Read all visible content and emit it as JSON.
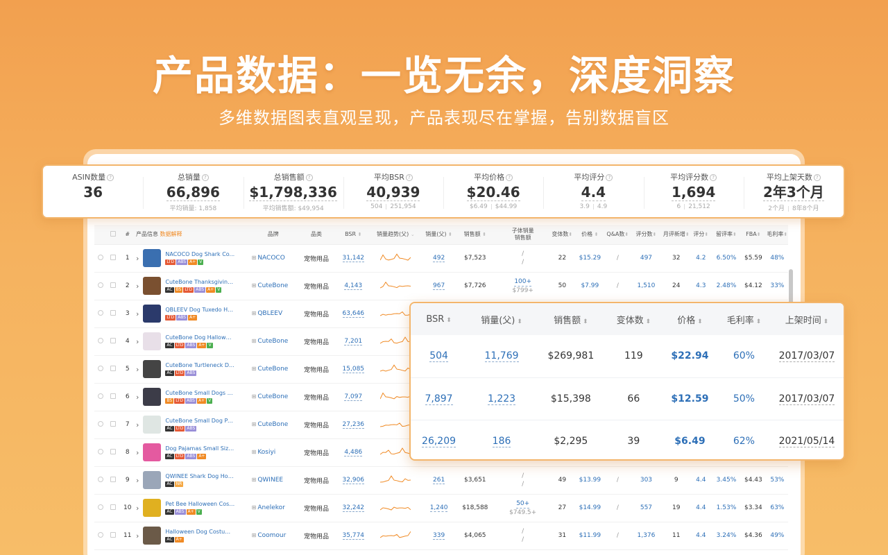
{
  "hero": {
    "title": "产品数据：一览无余，深度洞察",
    "subtitle": "多维数据图表直观呈现，产品表现尽在掌握，告别数据盲区"
  },
  "stats": [
    {
      "label": "ASIN数量",
      "value": "36",
      "sub": ""
    },
    {
      "label": "总销量",
      "value": "66,896",
      "sub": "平均销量: 1,858"
    },
    {
      "label": "总销售额",
      "value": "$1,798,336",
      "sub": "平均销售额: $49,954"
    },
    {
      "label": "平均BSR",
      "value": "40,939",
      "sub_a": "504",
      "sub_b": "251,954"
    },
    {
      "label": "平均价格",
      "value": "$20.46",
      "sub_a": "$6.49",
      "sub_b": "$44.99"
    },
    {
      "label": "平均评分",
      "value": "4.4",
      "sub_a": "3.9",
      "sub_b": "4.9"
    },
    {
      "label": "平均评分数",
      "value": "1,694",
      "sub_a": "6",
      "sub_b": "21,512"
    },
    {
      "label": "平均上架天数",
      "value": "2年3个月",
      "sub_a": "2个月",
      "sub_b": "8年8个月"
    }
  ],
  "table": {
    "headers": {
      "num": "#",
      "product": "产品信息",
      "explain": "数据解释",
      "brand": "品牌",
      "category": "品类",
      "bsr": "BSR",
      "trend": "销量趋势(父)",
      "sales": "销量(父)",
      "revenue": "销售额",
      "child_a": "子体销量",
      "child_b": "销售额",
      "variants": "变体数",
      "price": "价格",
      "qa": "Q&A数",
      "ratings": "评分数",
      "monthly": "月评新增",
      "score": "评分",
      "retention": "留评率",
      "fba": "FBA",
      "margin": "毛利率"
    },
    "rows": [
      {
        "n": "1",
        "name": "NACOCO Dog Shark Co...",
        "tags": [
          "LTD",
          "ABS",
          "A+",
          "V"
        ],
        "brand": "NACOCO",
        "cat": "宠物用品",
        "bsr": "31,142",
        "sales": "492",
        "rev": "$7,523",
        "child": "/",
        "childrev": "/",
        "var": "22",
        "price": "$15.29",
        "qa": "/",
        "ratings": "497",
        "monthly": "32",
        "score": "4.2",
        "ret": "6.50%",
        "fba": "$5.59",
        "margin": "48%",
        "thumb": "#3a6fb0"
      },
      {
        "n": "2",
        "name": "CuteBone Thanksgiving...",
        "tags": [
          "AC",
          "BS",
          "LTD",
          "ABS",
          "A+",
          "V"
        ],
        "brand": "CuteBone",
        "cat": "宠物用品",
        "bsr": "4,143",
        "sales": "967",
        "rev": "$7,726",
        "child": "100+",
        "childrev": "$799+",
        "var": "50",
        "price": "$7.99",
        "qa": "/",
        "ratings": "1,510",
        "monthly": "24",
        "score": "4.3",
        "ret": "2.48%",
        "fba": "$4.12",
        "margin": "33%",
        "thumb": "#7a5030"
      },
      {
        "n": "3",
        "name": "QBLEEV Dog Tuxedo Ha...",
        "tags": [
          "LTD",
          "ABS",
          "A+"
        ],
        "brand": "QBLEEV",
        "cat": "宠物用品",
        "bsr": "63,646",
        "thumb": "#2b3a6b"
      },
      {
        "n": "4",
        "name": "CuteBone Dog Hallowee...",
        "tags": [
          "AC",
          "LTD",
          "ABS",
          "A+",
          "V"
        ],
        "brand": "CuteBone",
        "cat": "宠物用品",
        "bsr": "7,201",
        "thumb": "#e8dfe8"
      },
      {
        "n": "5",
        "name": "CuteBone Turtleneck D...",
        "tags": [
          "AC",
          "LTD",
          "ABS"
        ],
        "brand": "CuteBone",
        "cat": "宠物用品",
        "bsr": "15,085",
        "thumb": "#444"
      },
      {
        "n": "6",
        "name": "CuteBone Small Dogs O...",
        "tags": [
          "BS",
          "LTD",
          "ABS",
          "A+",
          "V"
        ],
        "brand": "CuteBone",
        "cat": "宠物用品",
        "bsr": "7,097",
        "thumb": "#3c3c48"
      },
      {
        "n": "7",
        "name": "CuteBone Small Dog Paj...",
        "tags": [
          "AC",
          "LTD",
          "ABS"
        ],
        "brand": "CuteBone",
        "cat": "宠物用品",
        "bsr": "27,236",
        "thumb": "#dfe6e3"
      },
      {
        "n": "8",
        "name": "Dog Pajamas Small Size...",
        "tags": [
          "AC",
          "LTD",
          "ABS",
          "A+"
        ],
        "brand": "Kosiyi",
        "cat": "宠物用品",
        "bsr": "4,486",
        "thumb": "#e45aa0"
      },
      {
        "n": "9",
        "name": "QWINEE Shark Dog Hoo...",
        "tags": [
          "AC",
          "NR"
        ],
        "brand": "QWINEE",
        "cat": "宠物用品",
        "bsr": "32,906",
        "sales": "261",
        "rev": "$3,651",
        "child": "/",
        "childrev": "/",
        "var": "49",
        "price": "$13.99",
        "qa": "/",
        "ratings": "303",
        "monthly": "9",
        "score": "4.4",
        "ret": "3.45%",
        "fba": "$4.43",
        "margin": "53%",
        "thumb": "#9aa6b8"
      },
      {
        "n": "10",
        "name": "Pet Bee Halloween Cost...",
        "tags": [
          "AC",
          "ABS",
          "A+",
          "V"
        ],
        "brand": "Anelekor",
        "cat": "宠物用品",
        "bsr": "32,242",
        "sales": "1,240",
        "rev": "$18,588",
        "child": "50+",
        "childrev": "$749.5+",
        "var": "27",
        "price": "$14.99",
        "qa": "/",
        "ratings": "557",
        "monthly": "19",
        "score": "4.4",
        "ret": "1.53%",
        "fba": "$3.34",
        "margin": "63%",
        "thumb": "#e0b020"
      },
      {
        "n": "11",
        "name": "Halloween Dog Costum...",
        "tags": [
          "AC",
          "A+"
        ],
        "brand": "Coomour",
        "cat": "宠物用品",
        "bsr": "35,774",
        "sales": "339",
        "rev": "$4,065",
        "child": "/",
        "childrev": "/",
        "var": "31",
        "price": "$11.99",
        "qa": "/",
        "ratings": "1,376",
        "monthly": "11",
        "score": "4.4",
        "ret": "3.24%",
        "fba": "$4.36",
        "margin": "49%",
        "thumb": "#6b5a48"
      }
    ]
  },
  "zoom": {
    "headers": [
      "BSR",
      "销量(父)",
      "销售额",
      "变体数",
      "价格",
      "毛利率",
      "上架时间"
    ],
    "rows": [
      [
        "504",
        "11,769",
        "$269,981",
        "119",
        "$22.94",
        "60%",
        "2017/03/07"
      ],
      [
        "7,897",
        "1,223",
        "$15,398",
        "66",
        "$12.59",
        "50%",
        "2017/03/07"
      ],
      [
        "26,209",
        "186",
        "$2,295",
        "39",
        "$6.49",
        "62%",
        "2021/05/14"
      ]
    ]
  },
  "colors": {
    "accent": "#f3b56b",
    "link": "#2d6fb7",
    "trend_line": "#f08a24"
  }
}
